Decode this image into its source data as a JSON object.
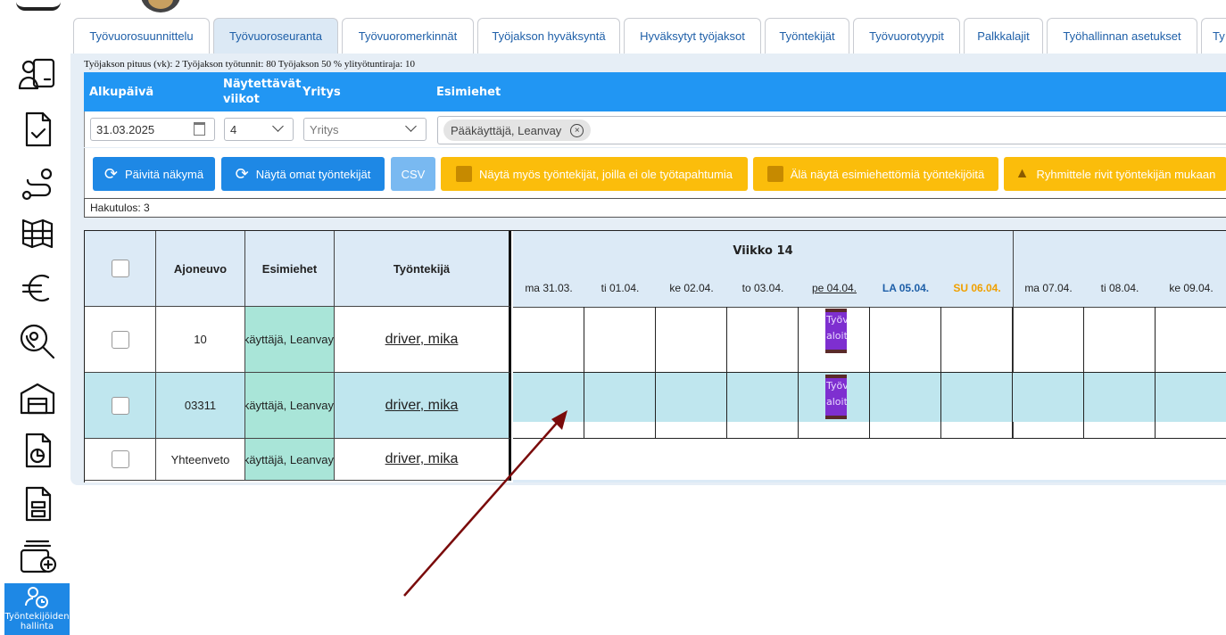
{
  "tabs": [
    "Työvuorosuunnittelu",
    "Työvuoroseuranta",
    "Työvuoromerkinnät",
    "Työjakson hyväksyntä",
    "Hyväksytyt työjaksot",
    "Työntekijät",
    "Työvuorotyypit",
    "Palkkalajit",
    "Työhallinnan asetukset",
    "Ty"
  ],
  "sidebar": {
    "active_label_1": "Työntekijöiden",
    "active_label_2": "hallinta"
  },
  "info": "Työjakson pituus (vk): 2  Työjakson työtunnit: 80  Työjakson 50 % ylityötuntiraja: 10",
  "filters": {
    "start_label": "Alkupäivä",
    "weeks_label_1": "Näytettävät",
    "weeks_label_2": "viikot",
    "company_label": "Yritys",
    "managers_label": "Esimiehet",
    "start_value": "31.03.2025",
    "weeks_value": "4",
    "company_placeholder": "Yritys",
    "manager_chip": "Pääkäyttäjä, Leanvay"
  },
  "buttons": {
    "refresh": "Päivitä näkymä",
    "own": "Näytä omat työntekijät",
    "csv": "CSV",
    "show_all": "Näytä myös työntekijät, joilla ei ole työtapahtumia",
    "hide_nomanager": "Älä näytä esimiehettömiä työntekijöitä",
    "group": "Ryhmittele rivit työntekijän mukaan"
  },
  "result": "Hakutulos: 3",
  "table": {
    "headers": {
      "vehicle": "Ajoneuvo",
      "managers": "Esimiehet",
      "employee": "Työntekijä"
    },
    "week": "Viikko 14",
    "days": [
      "ma 31.03.",
      "ti 01.04.",
      "ke 02.04.",
      "to 03.04.",
      "pe 04.04.",
      "LA 05.04.",
      "SU 06.04.",
      "ma 07.04.",
      "ti 08.04.",
      "ke 09.04."
    ],
    "rows": [
      {
        "vehicle": "10",
        "manager": "Pääkäyttäjä, Leanvay",
        "employee": "driver, mika"
      },
      {
        "vehicle": "03311",
        "manager": "Pääkäyttäjä, Leanvay",
        "employee": "driver, mika"
      },
      {
        "vehicle": "Yhteenveto",
        "manager": "Pääkäyttäjä, Leanvay",
        "employee": "driver, mika"
      }
    ],
    "event_text_1": "Työv",
    "event_text_2": "aloit"
  },
  "colors": {
    "accent": "#2196f3",
    "warning": "#fbbd0b",
    "manager_cell": "#a9e5d8",
    "event": "#7e2fd0",
    "arrow": "#7a0b0b"
  }
}
